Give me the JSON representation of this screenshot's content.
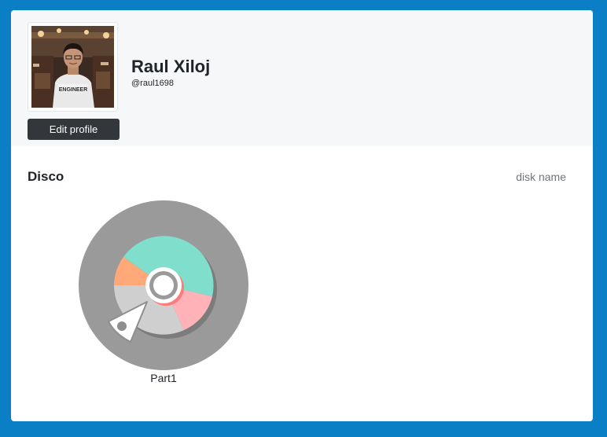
{
  "profile": {
    "name": "Raul Xiloj",
    "username": "@raul1698",
    "edit_button": "Edit profile",
    "photo_shirt_text": "ENGINEER"
  },
  "section": {
    "title": "Disco",
    "disk_name_label": "disk name"
  },
  "disks": [
    {
      "label": "Part1",
      "icon": "disk-icon"
    }
  ],
  "colors": {
    "frame": "#0a7fc6",
    "header_bg": "#f6f7f9",
    "button_bg": "#33363b",
    "disk_outer": "#9a9a9a",
    "segment_teal": "#7fdfcc",
    "segment_orange": "#ffa97a",
    "segment_pink": "#ffb3b8",
    "segment_gray": "#cfcfcf"
  }
}
